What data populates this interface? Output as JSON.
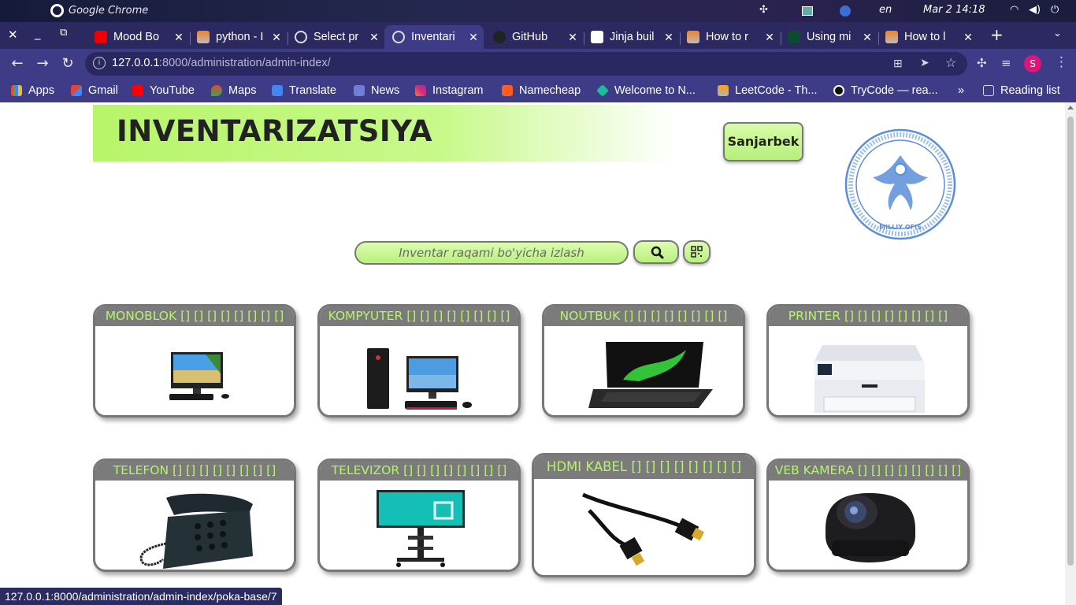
{
  "os": {
    "app_name": "Google Chrome",
    "lang": "en",
    "datetime": "Mar 2  14:18"
  },
  "tabs": [
    {
      "title": "Mood Bo",
      "active": false
    },
    {
      "title": "python - I",
      "active": false
    },
    {
      "title": "Select pr",
      "active": false
    },
    {
      "title": "Inventari",
      "active": true
    },
    {
      "title": "GitHub",
      "active": false
    },
    {
      "title": "Jinja buil",
      "active": false
    },
    {
      "title": "How to r",
      "active": false
    },
    {
      "title": "Using mi",
      "active": false
    },
    {
      "title": "How to l",
      "active": false
    }
  ],
  "omnibox": {
    "host": "127.0.0.1",
    "path": ":8000/administration/admin-index/"
  },
  "bookmarks": [
    {
      "label": "Apps"
    },
    {
      "label": "Gmail"
    },
    {
      "label": "YouTube"
    },
    {
      "label": "Maps"
    },
    {
      "label": "Translate"
    },
    {
      "label": "News"
    },
    {
      "label": "Instagram"
    },
    {
      "label": "Namecheap"
    },
    {
      "label": "Welcome to N..."
    },
    {
      "label": "LeetCode - Th..."
    },
    {
      "label": "TryCode — rea..."
    },
    {
      "label": "Reading list"
    }
  ],
  "page": {
    "title": "INVENTARIZATSIYA",
    "user_button": "Sanjarbek",
    "seal_text": "MILLIY OFIS",
    "search_placeholder": "Inventar raqami bo'yicha izlash"
  },
  "cards": [
    {
      "title": "MONOBLOK [] [] [] [] [] [] [] []",
      "icon": "monoblock-image"
    },
    {
      "title": "KOMPYUTER [] [] [] [] [] [] [] []",
      "icon": "computer-image"
    },
    {
      "title": "NOUTBUK [] [] [] [] [] [] [] []",
      "icon": "laptop-image"
    },
    {
      "title": "PRINTER [] [] [] [] [] [] [] []",
      "icon": "printer-image"
    },
    {
      "title": "TELEFON [] [] [] [] [] [] [] []",
      "icon": "telephone-image"
    },
    {
      "title": "TELEVIZOR [] [] [] [] [] [] [] []",
      "icon": "tv-image"
    },
    {
      "title": "HDMI KABEL [] [] [] [] [] [] [] []",
      "icon": "hdmi-cable-image"
    },
    {
      "title": "VEB KAMERA [] [] [] [] [] [] [] []",
      "icon": "webcam-image"
    }
  ],
  "status_url": "127.0.0.1:8000/administration/admin-index/poka-base/7",
  "colors": {
    "accent_green": "#b6f56b",
    "card_header": "#7b7b7b",
    "chrome_bg": "#3e3c87",
    "tab_strip": "#2c2960"
  }
}
